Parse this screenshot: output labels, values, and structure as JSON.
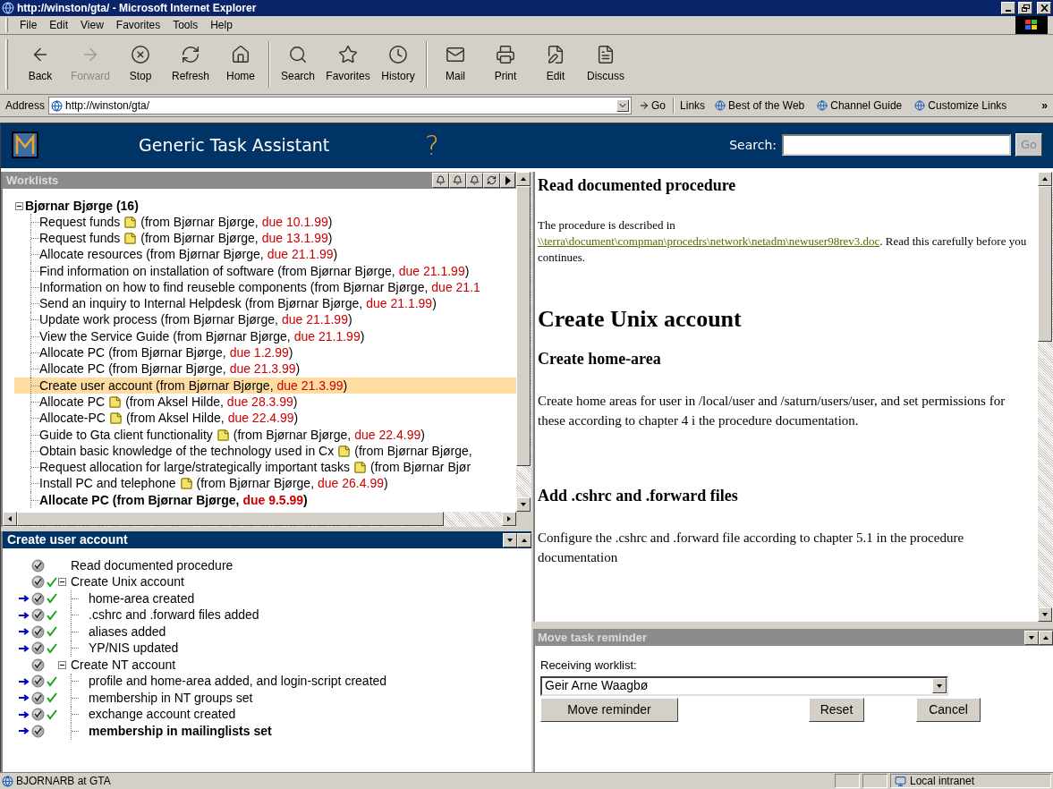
{
  "window": {
    "title": "http://winston/gta/ - Microsoft Internet Explorer"
  },
  "menu": [
    "File",
    "Edit",
    "View",
    "Favorites",
    "Tools",
    "Help"
  ],
  "toolbar": [
    {
      "kind": "back",
      "label": "Back",
      "disabled": false
    },
    {
      "kind": "forward",
      "label": "Forward",
      "disabled": true
    },
    {
      "kind": "stop",
      "label": "Stop",
      "disabled": false
    },
    {
      "kind": "refresh",
      "label": "Refresh",
      "disabled": false
    },
    {
      "kind": "home",
      "label": "Home",
      "disabled": false
    },
    {
      "kind": "search",
      "label": "Search",
      "disabled": false
    },
    {
      "kind": "favorites",
      "label": "Favorites",
      "disabled": false
    },
    {
      "kind": "history",
      "label": "History",
      "disabled": false
    },
    {
      "kind": "mail",
      "label": "Mail",
      "disabled": false
    },
    {
      "kind": "print",
      "label": "Print",
      "disabled": false
    },
    {
      "kind": "edit",
      "label": "Edit",
      "disabled": false
    },
    {
      "kind": "discuss",
      "label": "Discuss",
      "disabled": false
    }
  ],
  "address": {
    "label": "Address",
    "value": "http://winston/gta/",
    "go": "Go",
    "links_label": "Links",
    "links": [
      "Best of the Web",
      "Channel Guide",
      "Customize Links"
    ],
    "more": "»"
  },
  "app": {
    "title": "Generic Task Assistant",
    "help": "?",
    "search_label": "Search:",
    "search_button": "Go"
  },
  "worklists": {
    "title": "Worklists",
    "group": {
      "label": "Bjørnar Bjørge (16)",
      "expanded": true
    },
    "items": [
      {
        "task": "Request funds",
        "note": true,
        "from": "(from Bjørnar Bjørge,",
        "due": "due 10.1.99",
        "end": ")",
        "bold": false,
        "selected": false
      },
      {
        "task": "Request funds",
        "note": true,
        "from": "(from Bjørnar Bjørge,",
        "due": "due 13.1.99",
        "end": ")",
        "bold": false,
        "selected": false
      },
      {
        "task": "Allocate resources",
        "note": false,
        "from": "(from Bjørnar Bjørge,",
        "due": "due 21.1.99",
        "end": ")",
        "bold": false,
        "selected": false
      },
      {
        "task": "Find information on installation of software",
        "note": false,
        "from": "(from Bjørnar Bjørge,",
        "due": "due 21.1.99",
        "end": ")",
        "bold": false,
        "selected": false
      },
      {
        "task": "Information on how to find reuseble components",
        "note": false,
        "from": "(from Bjørnar Bjørge,",
        "due": "due 21.1",
        "bold": false,
        "selected": false
      },
      {
        "task": "Send an inquiry to Internal Helpdesk",
        "note": false,
        "from": "(from Bjørnar Bjørge,",
        "due": "due 21.1.99",
        "end": ")",
        "bold": false,
        "selected": false
      },
      {
        "task": "Update work process",
        "note": false,
        "from": "(from Bjørnar Bjørge,",
        "due": "due 21.1.99",
        "end": ")",
        "bold": false,
        "selected": false
      },
      {
        "task": "View the Service Guide",
        "note": false,
        "from": "(from Bjørnar Bjørge,",
        "due": "due 21.1.99",
        "end": ")",
        "bold": false,
        "selected": false
      },
      {
        "task": "Allocate PC",
        "note": false,
        "from": "(from Bjørnar Bjørge,",
        "due": "due 1.2.99",
        "end": ")",
        "bold": false,
        "selected": false
      },
      {
        "task": "Allocate PC",
        "note": false,
        "from": "(from Bjørnar Bjørge,",
        "due": "due 21.3.99",
        "end": ")",
        "bold": false,
        "selected": false
      },
      {
        "task": "Create user account",
        "note": false,
        "from": "(from Bjørnar Bjørge,",
        "due": "due 21.3.99",
        "end": ")",
        "bold": false,
        "selected": true
      },
      {
        "task": "Allocate PC",
        "note": true,
        "from": "(from Aksel Hilde,",
        "due": "due 28.3.99",
        "end": ")",
        "bold": false,
        "selected": false
      },
      {
        "task": "Allocate-PC",
        "note": true,
        "from": "(from Aksel Hilde,",
        "due": "due 22.4.99",
        "end": ")",
        "bold": false,
        "selected": false
      },
      {
        "task": "Guide to Gta client functionality",
        "note": true,
        "from": "(from Bjørnar Bjørge,",
        "due": "due 22.4.99",
        "end": ")",
        "bold": false,
        "selected": false
      },
      {
        "task": "Obtain basic knowledge of the technology used in Cx",
        "note": true,
        "from": "(from Bjørnar Bjørge,",
        "bold": false,
        "selected": false
      },
      {
        "task": "Request allocation for large/strategically important tasks",
        "note": true,
        "from": "(from Bjørnar Bjør",
        "bold": false,
        "selected": false
      },
      {
        "task": "Install PC and telephone",
        "note": true,
        "from": "(from Bjørnar Bjørge,",
        "due": "due 26.4.99",
        "end": ")",
        "bold": false,
        "selected": false
      },
      {
        "task": "Allocate PC",
        "note": false,
        "from": "(from Bjørnar Bjørge,",
        "due": "due 9.5.99",
        "end": ")",
        "bold": true,
        "selected": false
      }
    ]
  },
  "task": {
    "title": "Create user account",
    "steps": [
      {
        "label": "Read documented procedure",
        "arrow": false,
        "done": false,
        "current": false
      },
      {
        "label": "Create Unix account",
        "arrow": false,
        "done": true,
        "current": false,
        "expanded": true,
        "children": [
          {
            "label": "home-area created",
            "arrow": true,
            "done": true,
            "current": false
          },
          {
            "label": ".cshrc and .forward files added",
            "arrow": true,
            "done": true,
            "current": false
          },
          {
            "label": "aliases added",
            "arrow": true,
            "done": true,
            "current": false
          },
          {
            "label": "YP/NIS updated",
            "arrow": true,
            "done": true,
            "current": false
          }
        ]
      },
      {
        "label": "Create NT account",
        "arrow": false,
        "done": false,
        "current": false,
        "expanded": true,
        "children": [
          {
            "label": "profile and home-area added, and login-script created",
            "arrow": true,
            "done": true,
            "current": false
          },
          {
            "label": "membership in NT groups set",
            "arrow": true,
            "done": true,
            "current": false
          },
          {
            "label": "exchange account created",
            "arrow": true,
            "done": true,
            "current": false
          },
          {
            "label": "membership in mailinglists set",
            "arrow": true,
            "done": false,
            "current": true
          }
        ]
      }
    ]
  },
  "document": [
    {
      "kind": "h3",
      "text": "Read documented procedure"
    },
    {
      "kind": "p",
      "text": "The procedure is described in",
      "link": "\\\\terra\\document\\compman\\procedrs\\network\\netadm\\newuser98rev3.doc",
      "after": ". Read this carefully before you continues.",
      "small": true
    },
    {
      "kind": "h1",
      "text": "Create Unix account"
    },
    {
      "kind": "h3",
      "text": "Create home-area"
    },
    {
      "kind": "p",
      "text": "Create home areas for user in /local/user and /saturn/users/user, and set permissions for these according to chapter 4 i the procedure documentation."
    },
    {
      "kind": "h3",
      "text": "Add .cshrc and .forward files"
    },
    {
      "kind": "p",
      "text": "Configure the .cshrc and .forward file according to chapter 5.1 in the procedure documentation"
    }
  ],
  "reminder": {
    "title": "Move task reminder",
    "field_label": "Receiving worklist:",
    "value": "Geir Arne Waagbø",
    "buttons": [
      "Move reminder",
      "Reset",
      "Cancel"
    ]
  },
  "status_bar": {
    "text": "BJORNARB at GTA",
    "zone": "Local intranet"
  }
}
